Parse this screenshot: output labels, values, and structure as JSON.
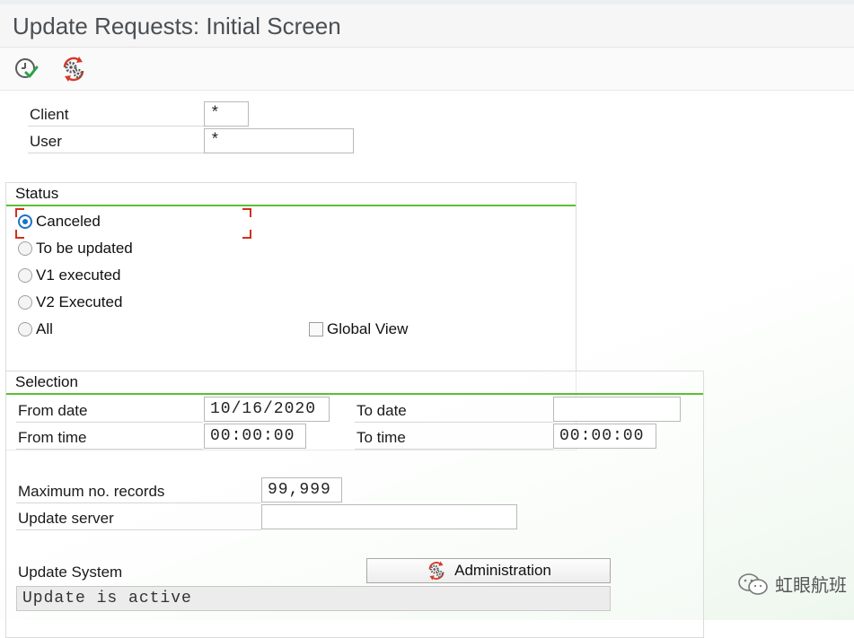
{
  "window": {
    "title": "Update Requests: Initial Screen"
  },
  "toolbar": {
    "execute_icon": "execute-clock-check-icon",
    "admin_icon": "gears-refresh-icon"
  },
  "header_fields": {
    "client_label": "Client",
    "client_value": "*",
    "user_label": "User",
    "user_value": "*"
  },
  "status_group": {
    "title": "Status",
    "options": [
      {
        "label": "Canceled",
        "selected": true
      },
      {
        "label": "To be updated",
        "selected": false
      },
      {
        "label": "V1 executed",
        "selected": false
      },
      {
        "label": "V2 Executed",
        "selected": false
      },
      {
        "label": "All",
        "selected": false
      }
    ],
    "global_view_label": "Global View",
    "global_view_checked": false
  },
  "selection_group": {
    "title": "Selection",
    "from_date_label": "From date",
    "from_date_value": "10/16/2020",
    "to_date_label": "To date",
    "to_date_value": "",
    "from_time_label": "From time",
    "from_time_value": "00:00:00",
    "to_time_label": "To time",
    "to_time_value": "00:00:00",
    "max_records_label": "Maximum no. records",
    "max_records_value": "99,999",
    "update_server_label": "Update server",
    "update_server_value": ""
  },
  "update_system": {
    "label": "Update System",
    "admin_button_label": "Administration",
    "status_text": "Update is active"
  },
  "watermark": {
    "text": "虹眼航班"
  },
  "colors": {
    "accent_green": "#5bbf34",
    "radio_blue": "#1a73c9",
    "focus_red": "#d12f1f"
  }
}
